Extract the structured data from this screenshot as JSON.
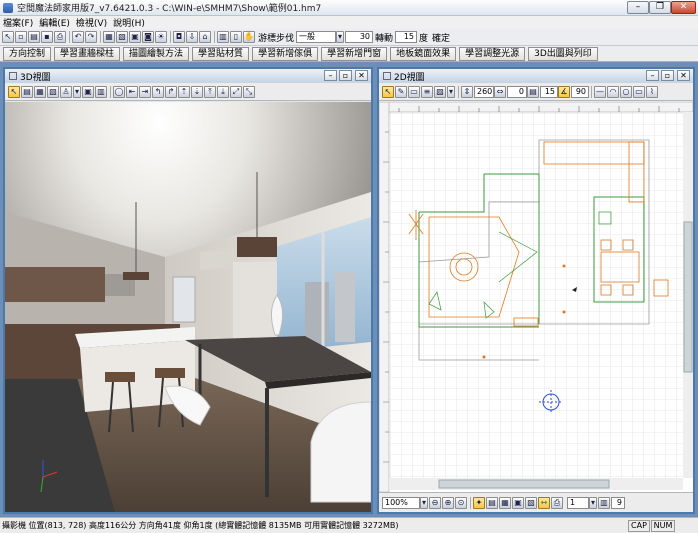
{
  "window": {
    "title": "空間魔法師家用版7_v7.6421.0.3 - C:\\WIN-e\\SMHM7\\Show\\範例01.hm7",
    "controls": [
      "–",
      "❐",
      "✕"
    ]
  },
  "menu": [
    "檔案(F)",
    "編輯(E)",
    "檢視(V)",
    "說明(H)"
  ],
  "toolbar": {
    "step_label": "游標步伐",
    "step_mode": "一般",
    "step_value": "30",
    "rotate_label": "轉動",
    "rotate_value": "15",
    "degree_label": "度",
    "confirm_label": "確定"
  },
  "learn_buttons": [
    "方向控制",
    "學習畫牆樑柱",
    "描圖繪製方法",
    "學習貼材質",
    "學習新增傢俱",
    "學習新增門窗",
    "地板鏡面效果",
    "學習調整光源",
    "3D出圖與列印"
  ],
  "view3d": {
    "title": "3D視圖"
  },
  "view2d": {
    "title": "2D視圖",
    "field_a": "260",
    "field_b": "0",
    "field_c": "15",
    "field_d": "90",
    "zoom": "100%",
    "page_select": "1",
    "page_count": "9"
  },
  "status": {
    "text": "攝影機 位置(813, 728) 高度116公分 方向角41度 仰角1度 (總實體記憶體 8135MB 可用實體記憶體 3272MB)",
    "cap": "CAP",
    "num": "NUM"
  },
  "colors": {
    "accent": "#4d79aa",
    "plan_orange": "#e07820",
    "plan_green": "#3c9a3c"
  }
}
